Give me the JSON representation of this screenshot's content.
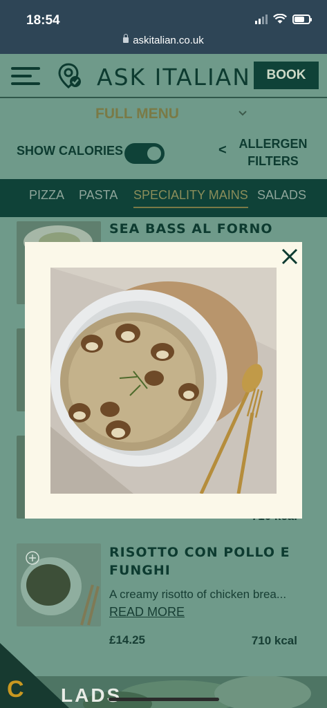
{
  "status_bar": {
    "time": "18:54",
    "url": "askitalian.co.uk"
  },
  "header": {
    "brand": "ASK ITALIAN",
    "book_label": "BOOK"
  },
  "menu_selector": {
    "label": "FULL MENU"
  },
  "filters": {
    "show_calories_label": "SHOW CALORIES",
    "show_calories_on": true,
    "arrow": "<",
    "allergen_line1": "ALLERGEN",
    "allergen_line2": "FILTERS"
  },
  "tabs": [
    {
      "label": "PIZZA"
    },
    {
      "label": "PASTA"
    },
    {
      "label": "SPECIALITY MAINS",
      "active": true
    },
    {
      "label": "SALADS"
    }
  ],
  "items": [
    {
      "title": "SEA BASS AL FORNO"
    },
    {
      "kcal_partial": "710 kcal"
    },
    {
      "title_line1": "RISOTTO CON POLLO E",
      "title_line2": "FUNGHI",
      "desc": "A creamy risotto of chicken brea...",
      "read_more": "READ MORE",
      "price": "£14.25",
      "kcal": "710 kcal"
    }
  ],
  "bottom": {
    "badge_letter": "C",
    "section_partial": "LADS"
  },
  "colors": {
    "brand_green": "#0f4238",
    "olive": "#7a7a46",
    "modal_bg": "#fbf8e9",
    "dim_bg": "#6f9a8a"
  },
  "icons": [
    "lock-icon",
    "signal-icon",
    "wifi-icon",
    "battery-icon",
    "hamburger-icon",
    "location-check-icon",
    "chevron-down-icon",
    "close-icon",
    "add-icon"
  ]
}
